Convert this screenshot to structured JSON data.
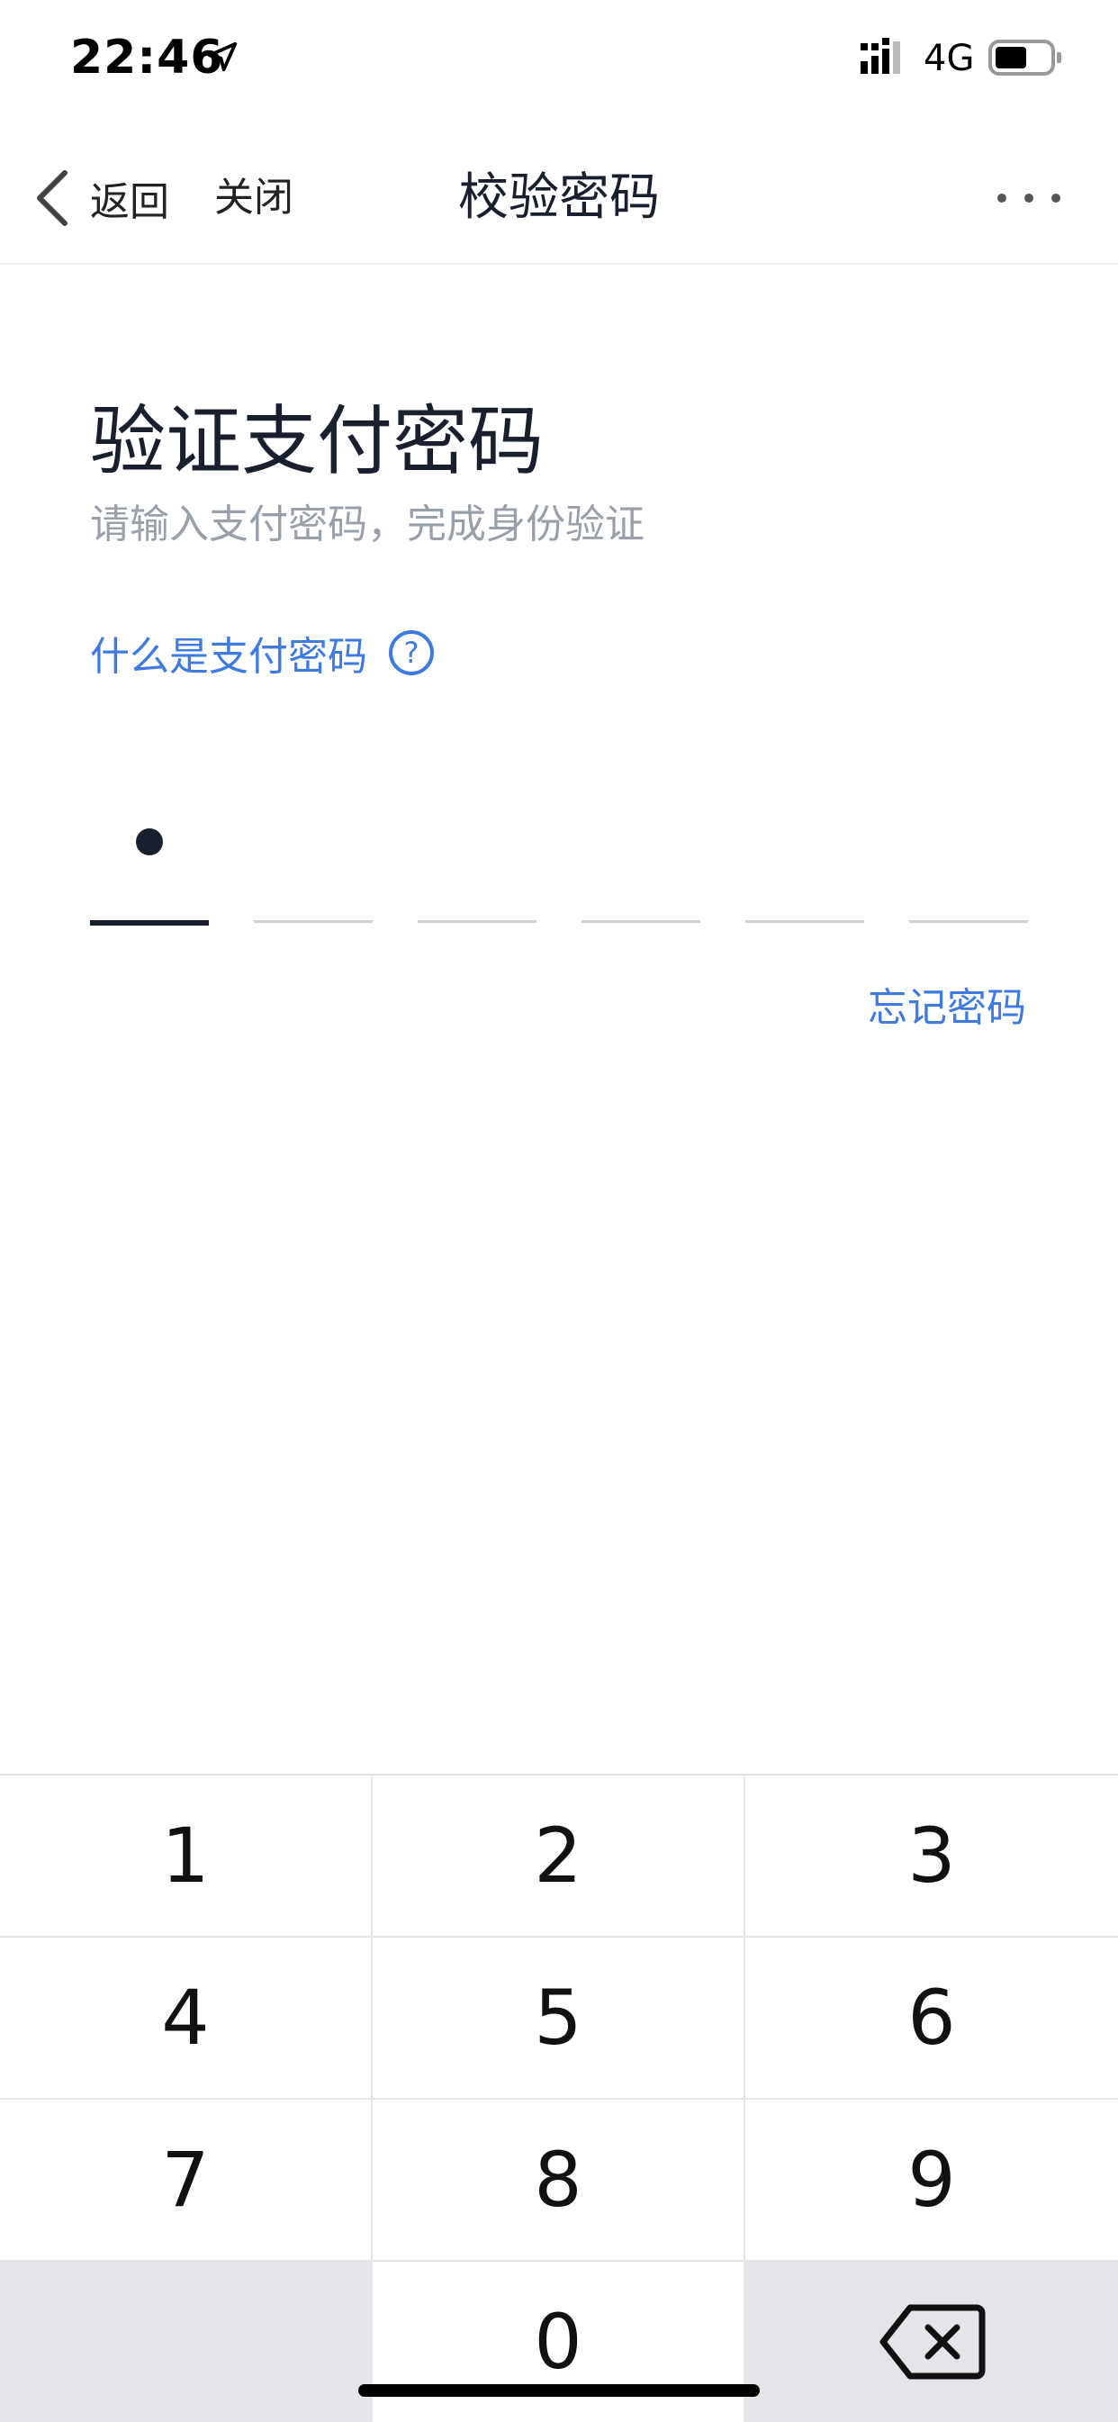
{
  "status_bar": {
    "time": "22:46",
    "network": "4G"
  },
  "nav": {
    "back_label": "返回",
    "close_label": "关闭",
    "title": "校验密码"
  },
  "content": {
    "heading": "验证支付密码",
    "subtitle": "请输入支付密码，完成身份验证",
    "help_link": "什么是支付密码",
    "help_icon": "?",
    "forgot_link": "忘记密码"
  },
  "pin": {
    "length": 6,
    "entered": 1
  },
  "keypad": {
    "keys": [
      "1",
      "2",
      "3",
      "4",
      "5",
      "6",
      "7",
      "8",
      "9",
      "",
      "0",
      "delete"
    ]
  },
  "icons": {
    "location": "location-arrow-icon",
    "signal": "signal-bars-icon",
    "battery": "battery-icon",
    "back": "chevron-left-icon",
    "more": "more-dots-icon",
    "delete": "backspace-icon"
  }
}
